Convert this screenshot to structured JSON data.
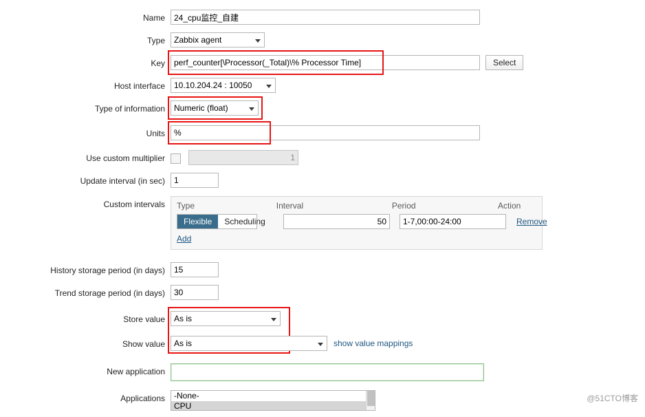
{
  "form": {
    "name": {
      "label": "Name",
      "value": "24_cpu监控_自建"
    },
    "type": {
      "label": "Type",
      "value": "Zabbix agent"
    },
    "key": {
      "label": "Key",
      "value": "perf_counter[\\Processor(_Total)\\% Processor Time]",
      "select_button": "Select"
    },
    "host_interface": {
      "label": "Host interface",
      "value": "10.10.204.24 : 10050"
    },
    "type_of_information": {
      "label": "Type of information",
      "value": "Numeric (float)"
    },
    "units": {
      "label": "Units",
      "value": "%"
    },
    "use_custom_multiplier": {
      "label": "Use custom multiplier",
      "value": "1",
      "checked": false
    },
    "update_interval": {
      "label": "Update interval (in sec)",
      "value": "1"
    },
    "custom_intervals": {
      "label": "Custom intervals",
      "columns": [
        "Type",
        "Interval",
        "Period",
        "Action"
      ],
      "rows": [
        {
          "type_flexible": "Flexible",
          "type_scheduling": "Scheduling",
          "active_type": "Flexible",
          "interval": "50",
          "period": "1-7,00:00-24:00",
          "action": "Remove"
        }
      ],
      "add_label": "Add"
    },
    "history_storage_period": {
      "label": "History storage period (in days)",
      "value": "15"
    },
    "trend_storage_period": {
      "label": "Trend storage period (in days)",
      "value": "30"
    },
    "store_value": {
      "label": "Store value",
      "value": "As is"
    },
    "show_value": {
      "label": "Show value",
      "value": "As is",
      "link": "show value mappings"
    },
    "new_application": {
      "label": "New application",
      "value": ""
    },
    "applications": {
      "label": "Applications",
      "options": [
        "-None-",
        "CPU"
      ],
      "selected": "CPU"
    }
  },
  "watermark": "@51CTO博客"
}
